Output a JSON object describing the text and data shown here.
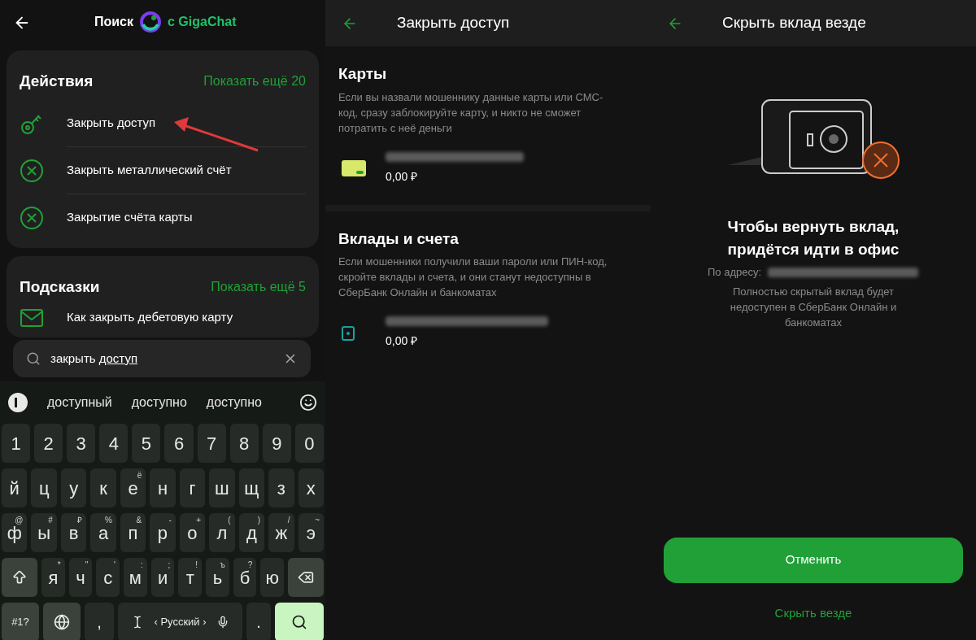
{
  "search_screen": {
    "title": "Поиск",
    "brand": "с GigaChat",
    "sections": [
      {
        "title": "Действия",
        "more": "Показать ещё 20",
        "items": [
          {
            "kind": "key",
            "label": "Закрыть доступ"
          },
          {
            "kind": "close",
            "label": "Закрыть металлический счёт"
          },
          {
            "kind": "close",
            "label": "Закрытие счёта карты"
          }
        ]
      },
      {
        "title": "Подсказки",
        "more": "Показать ещё 5",
        "items": [
          {
            "kind": "article",
            "label": "Как закрыть дебетовую карту"
          }
        ]
      }
    ],
    "search": {
      "parts": [
        {
          "text": "закрыть ",
          "underlined": false
        },
        {
          "text": "доступ",
          "underlined": true
        }
      ]
    },
    "keyboard": {
      "suggestions": [
        "доступный",
        "доступно",
        "доступно"
      ],
      "rows": [
        {
          "keys": [
            {
              "label": "1"
            },
            {
              "label": "2"
            },
            {
              "label": "3"
            },
            {
              "label": "4"
            },
            {
              "label": "5"
            },
            {
              "label": "6"
            },
            {
              "label": "7"
            },
            {
              "label": "8"
            },
            {
              "label": "9"
            },
            {
              "label": "0"
            }
          ]
        },
        {
          "keys": [
            {
              "label": "й"
            },
            {
              "label": "ц"
            },
            {
              "label": "у"
            },
            {
              "label": "к"
            },
            {
              "label": "е",
              "hint": "ё"
            },
            {
              "label": "н"
            },
            {
              "label": "г"
            },
            {
              "label": "ш"
            },
            {
              "label": "щ"
            },
            {
              "label": "з"
            },
            {
              "label": "х"
            }
          ]
        },
        {
          "keys": [
            {
              "label": "ф",
              "hint": "@"
            },
            {
              "label": "ы",
              "hint": "#"
            },
            {
              "label": "в",
              "hint": "₽"
            },
            {
              "label": "а",
              "hint": "%"
            },
            {
              "label": "п",
              "hint": "&"
            },
            {
              "label": "р",
              "hint": "-"
            },
            {
              "label": "о",
              "hint": "+"
            },
            {
              "label": "л",
              "hint": "("
            },
            {
              "label": "д",
              "hint": ")"
            },
            {
              "label": "ж",
              "hint": "/"
            },
            {
              "label": "э",
              "hint": "~"
            }
          ]
        },
        {
          "keys": [
            {
              "kind": "shift"
            },
            {
              "label": "я",
              "hint": "*"
            },
            {
              "label": "ч",
              "hint": "\""
            },
            {
              "label": "с",
              "hint": "'"
            },
            {
              "label": "м",
              "hint": ":"
            },
            {
              "label": "и",
              "hint": ";"
            },
            {
              "label": "т",
              "hint": "!"
            },
            {
              "label": "ь",
              "hint": "ъ"
            },
            {
              "label": "б",
              "hint": "?"
            },
            {
              "label": "ю"
            },
            {
              "kind": "backspace"
            }
          ]
        }
      ],
      "bottom": {
        "symbols": "#1?",
        "comma": ",",
        "space": "‹ Русский ›",
        "period": "."
      }
    }
  },
  "access_screen": {
    "title": "Закрыть доступ",
    "sections": [
      {
        "title": "Карты",
        "description": "Если вы назвали мошеннику данные карты или СМС-код, сразу заблокируйте карту, и никто не сможет потратить с неё деньги",
        "items": [
          {
            "kind": "card",
            "amount": "0,00 ₽"
          }
        ]
      },
      {
        "title": "Вклады и счета",
        "description": "Если мошенники получили ваши пароли или ПИН-код, скройте вклады и счета, и они станут недоступны в СберБанк Онлайн и банкоматах",
        "items": [
          {
            "kind": "deposit",
            "amount": "0,00 ₽"
          }
        ]
      }
    ]
  },
  "hide_screen": {
    "title": "Скрыть вклад везде",
    "heading": "Чтобы вернуть вклад, придётся идти в офис",
    "address_label": "По адресу:",
    "note": "Полностью скрытый вклад будет недоступен в СберБанк Онлайн и банкоматах",
    "primary_button": "Отменить",
    "secondary_button": "Скрыть везде"
  }
}
